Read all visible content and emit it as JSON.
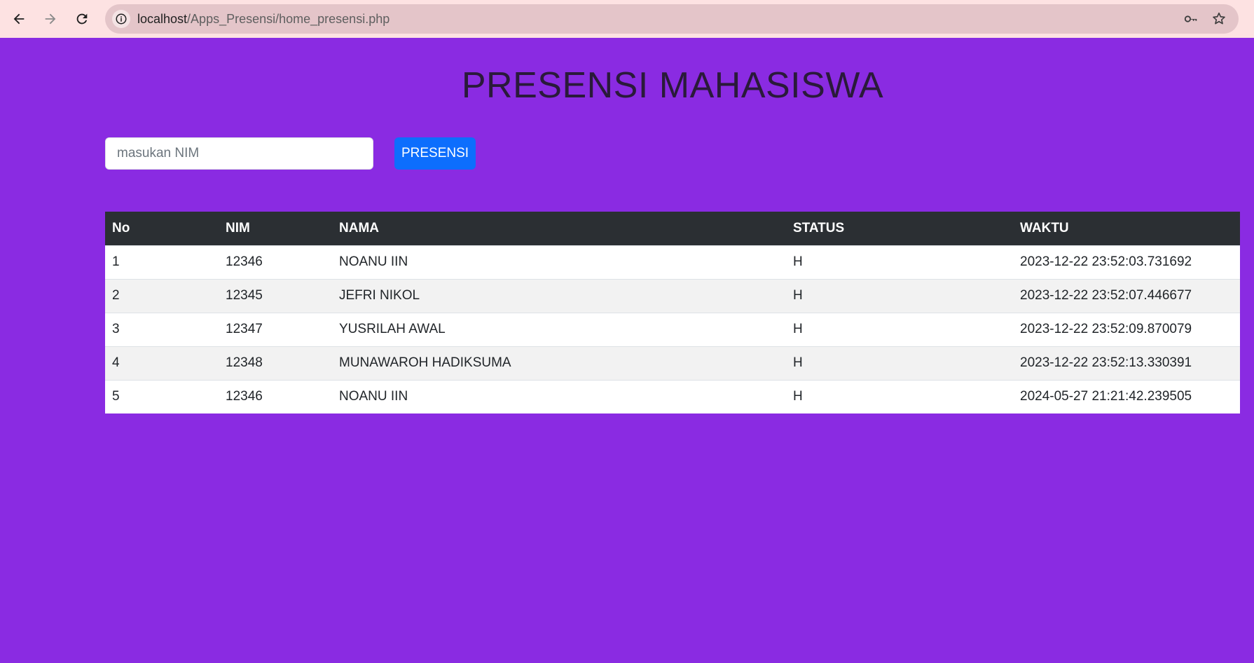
{
  "browser": {
    "url_host": "localhost",
    "url_path": "/Apps_Presensi/home_presensi.php",
    "icons": {
      "back": "arrow-left-icon",
      "forward": "arrow-right-icon",
      "reload": "reload-icon",
      "site_info": "info-icon",
      "password": "key-icon",
      "bookmark": "star-icon"
    }
  },
  "page": {
    "title": "PRESENSI MAHASISWA",
    "background_color": "#8a2be2"
  },
  "form": {
    "nim_placeholder": "masukan NIM",
    "nim_value": "",
    "submit_label": "PRESENSI",
    "submit_color": "#0d6efd"
  },
  "table": {
    "headers": {
      "no": "No",
      "nim": "NIM",
      "nama": "NAMA",
      "status": "STATUS",
      "waktu": "WAKTU"
    },
    "header_color": "#2b2f33",
    "rows": [
      {
        "no": "1",
        "nim": "12346",
        "nama": "NOANU IIN",
        "status": "H",
        "waktu": "2023-12-22 23:52:03.731692"
      },
      {
        "no": "2",
        "nim": "12345",
        "nama": "JEFRI NIKOL",
        "status": "H",
        "waktu": "2023-12-22 23:52:07.446677"
      },
      {
        "no": "3",
        "nim": "12347",
        "nama": "YUSRILAH AWAL",
        "status": "H",
        "waktu": "2023-12-22 23:52:09.870079"
      },
      {
        "no": "4",
        "nim": "12348",
        "nama": "MUNAWAROH HADIKSUMA",
        "status": "H",
        "waktu": "2023-12-22 23:52:13.330391"
      },
      {
        "no": "5",
        "nim": "12346",
        "nama": "NOANU IIN",
        "status": "H",
        "waktu": "2024-05-27 21:21:42.239505"
      }
    ]
  }
}
